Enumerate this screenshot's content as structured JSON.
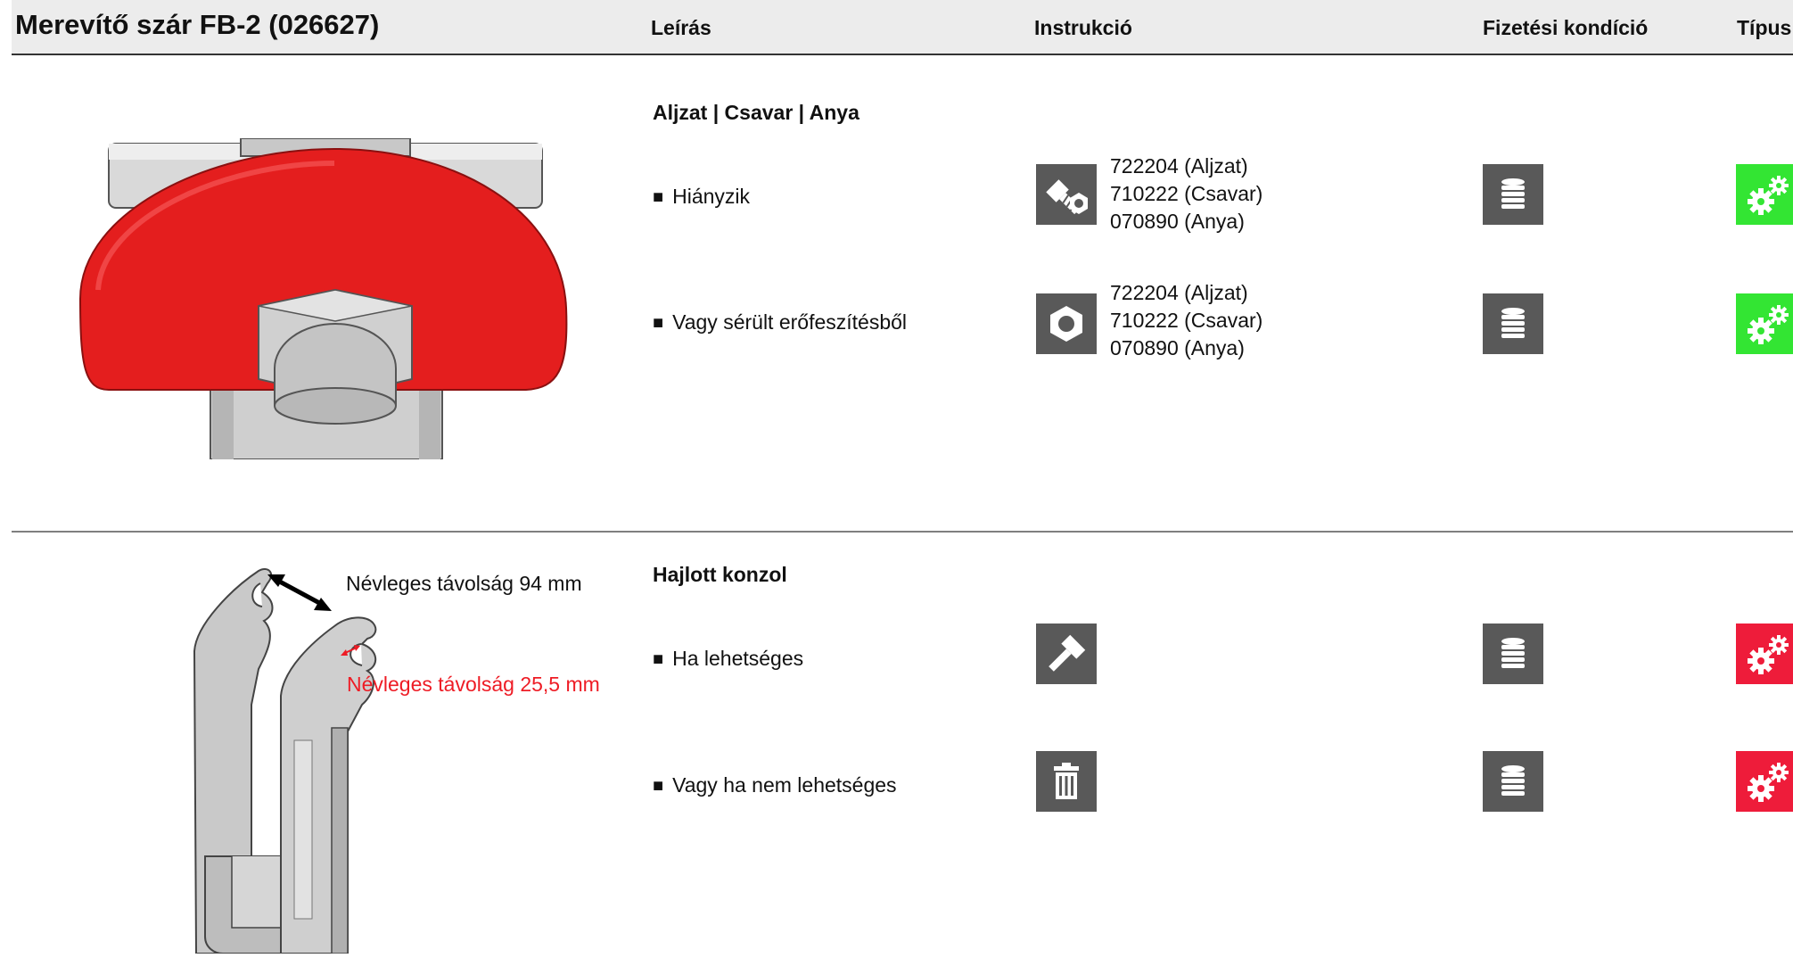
{
  "header": {
    "title": "Merevítő szár FB-2 (026627)",
    "col_description": "Leírás",
    "col_instruction": "Instrukció",
    "col_payment": "Fizetési kondíció",
    "col_type": "Típus"
  },
  "sections": [
    {
      "title": "Aljzat | Csavar | Anya",
      "rows": [
        {
          "description": "Hiányzik",
          "instruction_icon": "bolt-nut-icon",
          "parts": [
            "722204 (Aljzat)",
            "710222 (Csavar)",
            "070890 (Anya)"
          ],
          "payment_icon": "coin-stack-icon",
          "type_icon": "gears-icon",
          "type_color": "#33e533"
        },
        {
          "description": "Vagy sérült erőfeszítésből",
          "instruction_icon": "nut-icon",
          "parts": [
            "722204 (Aljzat)",
            "710222 (Csavar)",
            "070890 (Anya)"
          ],
          "payment_icon": "coin-stack-icon",
          "type_icon": "gears-icon",
          "type_color": "#33e533"
        }
      ]
    },
    {
      "title": "Hajlott konzol",
      "annotations": {
        "distance_black": "Névleges távolság 94 mm",
        "distance_red": "Névleges távolság 25,5 mm"
      },
      "rows": [
        {
          "description": "Ha lehetséges",
          "instruction_icon": "hammer-icon",
          "payment_icon": "coin-stack-icon",
          "type_icon": "gears-icon",
          "type_color": "#ee1c3a"
        },
        {
          "description": "Vagy ha nem lehetséges",
          "instruction_icon": "trash-icon",
          "payment_icon": "coin-stack-icon",
          "type_icon": "gears-icon",
          "type_color": "#ee1c3a"
        }
      ]
    }
  ],
  "colors": {
    "header_bg": "#ececec",
    "icon_bg": "#595959",
    "green": "#33e533",
    "red": "#ee1c3a",
    "annotation_red": "#ee1c25"
  }
}
